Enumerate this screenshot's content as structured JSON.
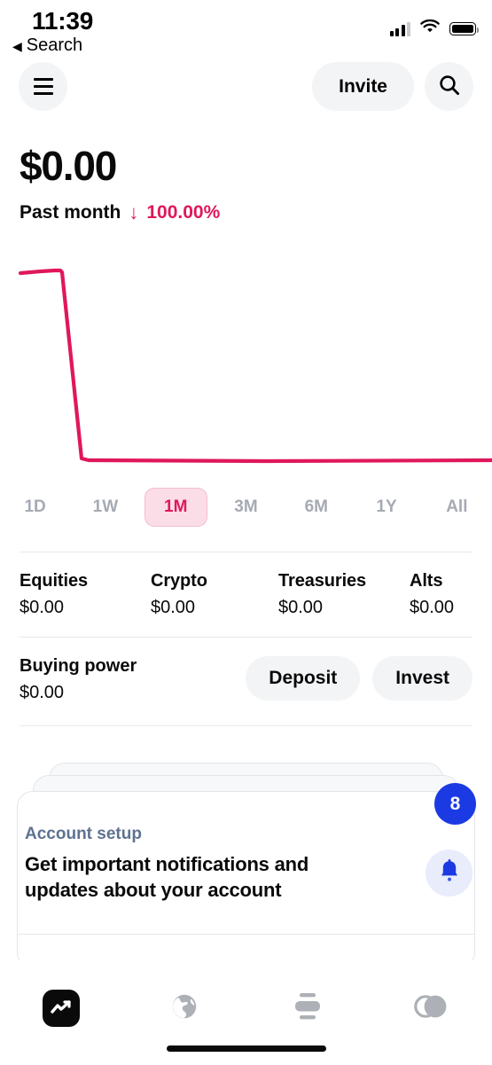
{
  "status_bar": {
    "time": "11:39",
    "back_label": "Search",
    "back_icon": "triangle-left-icon",
    "cellular_icon": "cellular-bars-icon",
    "wifi_icon": "wifi-icon",
    "battery_icon": "battery-full-icon"
  },
  "navbar": {
    "menu_icon": "hamburger-menu-icon",
    "invite_label": "Invite",
    "search_icon": "search-icon"
  },
  "portfolio": {
    "balance": "$0.00",
    "period_label": "Past month",
    "change_arrow": "↓",
    "change_pct": "100.00%",
    "change_color": "#e0175c"
  },
  "ranges": [
    {
      "label": "1D",
      "active": false
    },
    {
      "label": "1W",
      "active": false
    },
    {
      "label": "1M",
      "active": true
    },
    {
      "label": "3M",
      "active": false
    },
    {
      "label": "6M",
      "active": false
    },
    {
      "label": "1Y",
      "active": false
    },
    {
      "label": "All",
      "active": false
    }
  ],
  "assets": [
    {
      "label": "Equities",
      "value": "$0.00"
    },
    {
      "label": "Crypto",
      "value": "$0.00"
    },
    {
      "label": "Treasuries",
      "value": "$0.00"
    },
    {
      "label": "Alts",
      "value": "$0.00"
    }
  ],
  "buying_power": {
    "label": "Buying power",
    "value": "$0.00",
    "deposit_label": "Deposit",
    "invest_label": "Invest"
  },
  "setup_card": {
    "kicker": "Account setup",
    "title": "Get important notifications and updates about your account",
    "badge_count": "8",
    "badge_color": "#1c3ae3",
    "bell_icon": "bell-icon"
  },
  "tabs": [
    {
      "name": "investing",
      "icon": "line-chart-icon",
      "active": true
    },
    {
      "name": "discover",
      "icon": "globe-icon",
      "active": false
    },
    {
      "name": "transfers",
      "icon": "stacked-bars-icon",
      "active": false
    },
    {
      "name": "account",
      "icon": "overlapping-circles-icon",
      "active": false
    }
  ],
  "chart_data": {
    "type": "line",
    "title": "Past month portfolio value",
    "xlabel": "",
    "ylabel": "",
    "grid": false,
    "legend": null,
    "line_color": "#e0175c",
    "x": [
      0,
      4,
      8,
      12,
      13,
      14,
      16,
      20,
      40,
      60,
      80,
      100
    ],
    "values": [
      100,
      100,
      99,
      100,
      100,
      45,
      0,
      0,
      0,
      0,
      0,
      0
    ],
    "ylim": [
      0,
      110
    ],
    "annotations": [
      "100.00% decrease over the past month",
      "ends at $0.00"
    ]
  }
}
